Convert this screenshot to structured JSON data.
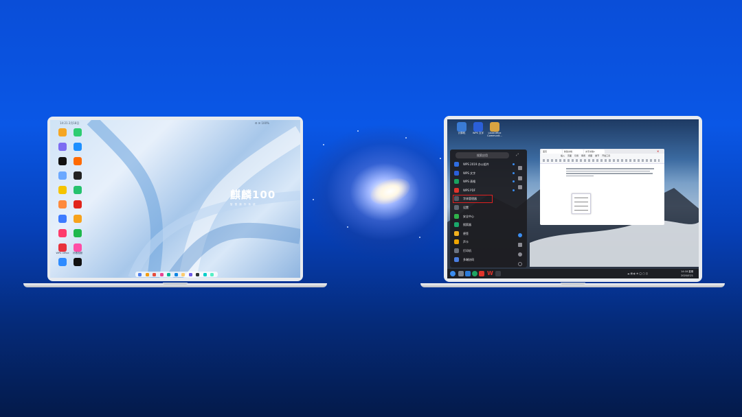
{
  "left_screen": {
    "status_bar": {
      "time": "14:21 2月18日",
      "indicators": "⚙ ✉ 100%"
    },
    "apps": [
      {
        "label": "",
        "color": "#f5a623"
      },
      {
        "label": "",
        "color": "#2ecc71"
      },
      {
        "label": "",
        "color": "#7c6cf2"
      },
      {
        "label": "",
        "color": "#1e90ff"
      },
      {
        "label": "",
        "color": "#111111"
      },
      {
        "label": "",
        "color": "#ff6a00"
      },
      {
        "label": "",
        "color": "#6aa8ff"
      },
      {
        "label": "",
        "color": "#222222"
      },
      {
        "label": "",
        "color": "#f5c400"
      },
      {
        "label": "",
        "color": "#25c26e"
      },
      {
        "label": "",
        "color": "#ff8a3d"
      },
      {
        "label": "",
        "color": "#e1251b"
      },
      {
        "label": "",
        "color": "#3d7bff"
      },
      {
        "label": "",
        "color": "#f7a21b"
      },
      {
        "label": "",
        "color": "#ff3b6b"
      },
      {
        "label": "",
        "color": "#1fb84c"
      },
      {
        "label": "WPS Office",
        "color": "#e8323c"
      },
      {
        "label": "好看视频",
        "color": "#ff4da6"
      },
      {
        "label": "",
        "color": "#2e8bff"
      },
      {
        "label": "",
        "color": "#111111"
      }
    ],
    "brand": {
      "name": "麒麟100",
      "subtitle": "智 慧 操 作 系 统"
    },
    "dock_colors": [
      "#4b7bec",
      "#f39c12",
      "#e74c3c",
      "#e84393",
      "#00b894",
      "#0984e3",
      "#fdcb6e",
      "#6c5ce7",
      "#2d3436",
      "#00cec9",
      "#55efc4"
    ]
  },
  "right_screen": {
    "desktop_icons": [
      {
        "label": "计算机",
        "color": "#3a7bd5"
      },
      {
        "label": "WPS 文字",
        "color": "#2b5fd9"
      },
      {
        "label": "LibreOffice Communit…",
        "color": "#d9a441"
      }
    ],
    "start_menu": {
      "search_placeholder": "搜索应用",
      "items": [
        {
          "label": "WPS 2019 办公组件",
          "color": "#2f6de1",
          "dot": true
        },
        {
          "label": "WPS 文字",
          "color": "#2b5fd9",
          "dot": true
        },
        {
          "label": "WPS 表格",
          "color": "#1aa260",
          "dot": true
        },
        {
          "label": "WPS PDF",
          "color": "#e0342c",
          "dot": true
        },
        {
          "label": "字体管理器",
          "color": "#555b66",
          "dot": false
        },
        {
          "label": "设置",
          "color": "#5f6670",
          "dot": false
        },
        {
          "label": "安全中心",
          "color": "#2fb34a",
          "dot": false
        },
        {
          "label": "搜索器",
          "color": "#1aa86b",
          "dot": false
        },
        {
          "label": "便签",
          "color": "#f2b01e",
          "dot": false
        },
        {
          "label": "声卡",
          "color": "#f0a500",
          "dot": false
        },
        {
          "label": "打印机",
          "color": "#6b7280",
          "dot": false
        },
        {
          "label": "多端协同",
          "color": "#4a7de0",
          "dot": false
        }
      ]
    },
    "document_window": {
      "tabs": [
        "首页",
        "新建文档",
        "文字文稿1"
      ],
      "menu_entries": [
        "插入",
        "页面",
        "引用",
        "审阅",
        "视图",
        "章节",
        "开发工具"
      ]
    },
    "taskbar": {
      "time": "14:18 星期",
      "date": "2020/07/1"
    }
  }
}
